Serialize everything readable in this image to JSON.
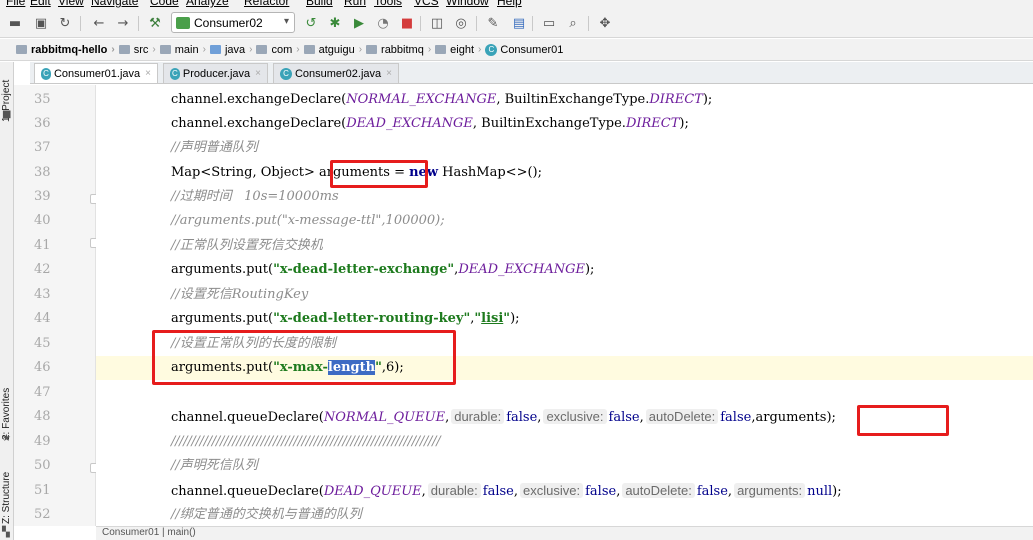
{
  "menu": [
    "File",
    "Edit",
    "View",
    "Navigate",
    "Code",
    "Analyze",
    "Refactor",
    "Build",
    "Run",
    "Tools",
    "VCS",
    "Window",
    "Help"
  ],
  "toolbar": {
    "run_config": "Consumer02"
  },
  "breadcrumb": [
    "rabbitmq-hello",
    "src",
    "main",
    "java",
    "com",
    "atguigu",
    "rabbitmq",
    "eight",
    "Consumer01"
  ],
  "tabs": [
    {
      "label": "Consumer01.java",
      "active": true
    },
    {
      "label": "Producer.java",
      "active": false
    },
    {
      "label": "Consumer02.java",
      "active": false
    }
  ],
  "side_tools": {
    "project": "1: Project",
    "favorites": "2: Favorites",
    "structure": "Z: Structure"
  },
  "code": {
    "line_numbers": [
      "35",
      "36",
      "37",
      "38",
      "39",
      "40",
      "41",
      "42",
      "43",
      "44",
      "45",
      "46",
      "47",
      "48",
      "49",
      "50",
      "51",
      "52"
    ],
    "l35": {
      "a": "channel.exchangeDeclare(",
      "b": "NORMAL_EXCHANGE",
      "c": ", BuiltinExchangeType.",
      "d": "DIRECT",
      "e": ");"
    },
    "l36": {
      "a": "channel.exchangeDeclare(",
      "b": "DEAD_EXCHANGE",
      "c": ", BuiltinExchangeType.",
      "d": "DIRECT",
      "e": ");"
    },
    "l37": "//声明普通队列",
    "l38": {
      "a": "Map<String, Object> ",
      "b": "arguments",
      "c": " = ",
      "d": "new",
      "e": " HashMap<>();"
    },
    "l39": "//过期时间   10s=10000ms",
    "l40": "//arguments.put(\"x-message-ttl\",100000);",
    "l41": "//正常队列设置死信交换机",
    "l42": {
      "a": "arguments.put(",
      "b": "\"x-dead-letter-exchange\"",
      "c": ",",
      "d": "DEAD_EXCHANGE",
      "e": ");"
    },
    "l43": "//设置死信RoutingKey",
    "l44": {
      "a": "arguments.put(",
      "b": "\"x-dead-letter-routing-key\"",
      "c": ",",
      "d": "\"",
      "e": "lisi",
      "f": "\"",
      "g": ");"
    },
    "l45": "//设置正常队列的长度的限制",
    "l46": {
      "a": "arguments.put(",
      "b": "\"x-max-",
      "c": "length",
      "d": "\"",
      "e": ",6);"
    },
    "l48": {
      "a": "channel.queueDeclare(",
      "b": "NORMAL_QUEUE",
      "c": ",",
      "h1": "durable:",
      "v1": "false",
      "s1": ",",
      "h2": "exclusive:",
      "v2": "false",
      "s2": ",",
      "h3": "autoDelete:",
      "v3": "false",
      "s3": ",",
      "d": "arguments",
      "e": ");"
    },
    "l49": "//////////////////////////////////////////////////////////////////",
    "l50": "//声明死信队列",
    "l51": {
      "a": "channel.queueDeclare(",
      "b": "DEAD_QUEUE",
      "c": ",",
      "h1": "durable:",
      "v1": "false",
      "s1": ",",
      "h2": "exclusive:",
      "v2": "false",
      "s2": ",",
      "h3": "autoDelete:",
      "v3": "false",
      "s3": ",",
      "h4": "arguments:",
      "v4": "null",
      "e": ");"
    },
    "l52": "//绑定普通的交换机与普通的队列"
  },
  "status": {
    "context": "Consumer01  |  main()"
  },
  "colors": {
    "annotation_red": "#e61c1c",
    "selection": "#3d6bc4",
    "constant": "#6d1d9c",
    "string": "#1d7a1d"
  }
}
